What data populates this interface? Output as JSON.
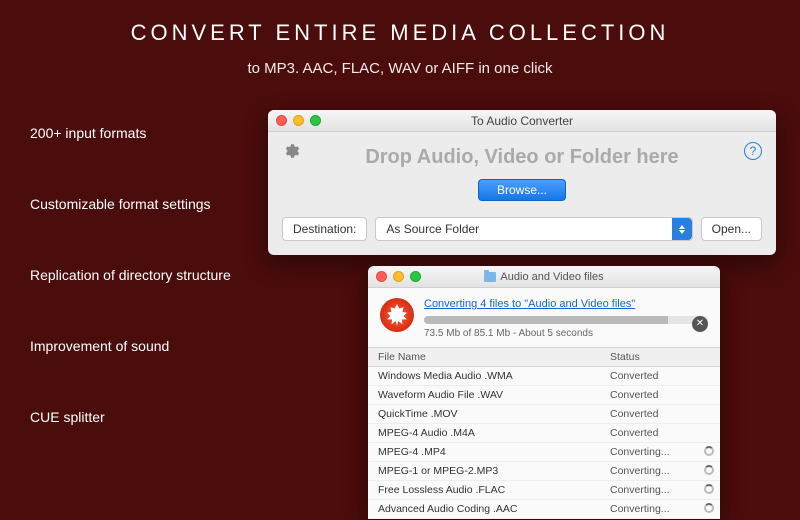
{
  "headline": "CONVERT  ENTIRE  MEDIA  COLLECTION",
  "subhead": "to MP3. AAC, FLAC, WAV or AIFF in one click",
  "features": [
    "200+ input formats",
    "Customizable format settings",
    "Replication of directory structure",
    "Improvement of sound",
    "CUE splitter"
  ],
  "converter": {
    "window_title": "To Audio Converter",
    "help_glyph": "?",
    "dropzone_text": "Drop Audio, Video or Folder here",
    "browse_label": "Browse...",
    "destination_label": "Destination:",
    "destination_value": "As Source Folder",
    "open_label": "Open..."
  },
  "progress": {
    "window_title": "Audio and Video files",
    "link_text": "Converting 4 files to \"Audio and Video files\"",
    "meta_text": "73.5 Mb of 85.1 Mb - About 5 seconds",
    "fill_percent": 86,
    "cancel_glyph": "✕",
    "columns": {
      "name": "File Name",
      "status": "Status"
    },
    "rows": [
      {
        "name": "Windows Media Audio .WMA",
        "status": "Converted",
        "busy": false
      },
      {
        "name": "Waveform Audio File .WAV",
        "status": "Converted",
        "busy": false
      },
      {
        "name": "QuickTime .MOV",
        "status": "Converted",
        "busy": false
      },
      {
        "name": "MPEG-4 Audio .M4A",
        "status": "Converted",
        "busy": false
      },
      {
        "name": "MPEG-4 .MP4",
        "status": "Converting...",
        "busy": true
      },
      {
        "name": "MPEG-1 or MPEG-2.MP3",
        "status": "Converting...",
        "busy": true
      },
      {
        "name": "Free Lossless Audio .FLAC",
        "status": "Converting...",
        "busy": true
      },
      {
        "name": "Advanced Audio Coding .AAC",
        "status": "Converting...",
        "busy": true
      }
    ]
  }
}
